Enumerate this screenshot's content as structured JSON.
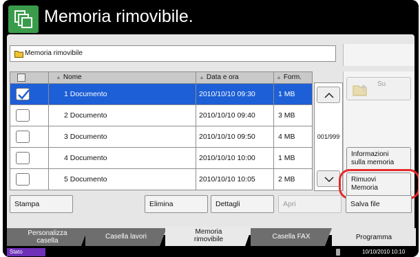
{
  "header": {
    "title": "Memoria rimovibile."
  },
  "path": {
    "label": "Memoria rimovibile"
  },
  "table": {
    "columns": {
      "name": "Nome",
      "date": "Data e ora",
      "format": "Form."
    },
    "rows": [
      {
        "name": "1  Documento",
        "date": "2010/10/10 09:30",
        "size": "1 MB",
        "selected": true
      },
      {
        "name": "2  Documento",
        "date": "2010/10/10 09:40",
        "size": "3 MB",
        "selected": false
      },
      {
        "name": "3  Documento",
        "date": "2010/10/10 09:50",
        "size": "4 MB",
        "selected": false
      },
      {
        "name": "4  Documento",
        "date": "2010/10/10 10:00",
        "size": "1 MB",
        "selected": false
      },
      {
        "name": "5  Documento",
        "date": "2010/10/10 10:05",
        "size": "2 MB",
        "selected": false
      }
    ]
  },
  "pager": {
    "counter": "001/999"
  },
  "side": {
    "su": "Su",
    "info": {
      "line1": "Informazioni",
      "line2": "sulla memoria"
    },
    "remove": {
      "line1": "Rimuovi",
      "line2": "Memoria"
    }
  },
  "actions": {
    "stampa": "Stampa",
    "elimina": "Elimina",
    "dettagli": "Dettagli",
    "apri": "Apri",
    "salva": "Salva file"
  },
  "tabs": {
    "personalizza": {
      "line1": "Personalizza",
      "line2": "casella"
    },
    "casella_lavori": "Casella lavori",
    "memoria": {
      "line1": "Memoria",
      "line2": "rimovibile"
    },
    "fax": "Casella FAX",
    "programma": "Programma"
  },
  "status": {
    "label": "Stato",
    "datetime": "10/10/2010  10:10"
  },
  "colors": {
    "header_icon": "#3a9c4b",
    "selection": "#1d5fd6",
    "highlight": "#e52a2a",
    "status_label": "#6f2fb8"
  },
  "icons": [
    "documents-icon",
    "folder-icon",
    "checkbox-icon",
    "arrow-up-icon",
    "arrow-down-icon",
    "folder-up-icon"
  ]
}
